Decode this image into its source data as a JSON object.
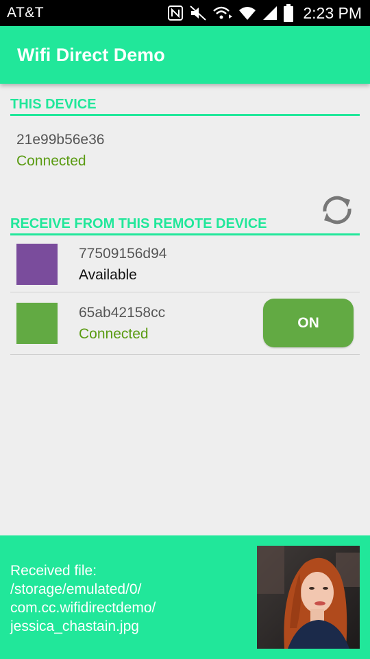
{
  "status_bar": {
    "carrier": "AT&T",
    "time": "2:23 PM",
    "icons": [
      "nfc-icon",
      "mute-icon",
      "wifi-direct-icon",
      "wifi-icon",
      "signal-icon",
      "battery-icon"
    ]
  },
  "app_bar": {
    "title": "Wifi Direct Demo"
  },
  "this_device": {
    "header": "THIS DEVICE",
    "name": "21e99b56e36",
    "status": "Connected"
  },
  "remote": {
    "header": "RECEIVE FROM THIS REMOTE DEVICE",
    "refresh_icon": "refresh-icon",
    "devices": [
      {
        "name": "77509156d94",
        "status": "Available",
        "color": "#7a4c9c"
      },
      {
        "name": "65ab42158cc",
        "status": "Connected",
        "color": "#62aa43",
        "toggle_label": "ON"
      }
    ]
  },
  "received": {
    "lines": [
      "Received file:",
      "/storage/emulated/0/",
      "com.cc.wifidirectdemo/",
      "jessica_chastain.jpg"
    ]
  },
  "colors": {
    "accent": "#21e79a",
    "connected_text": "#5a9b12",
    "on_button": "#62aa43"
  }
}
